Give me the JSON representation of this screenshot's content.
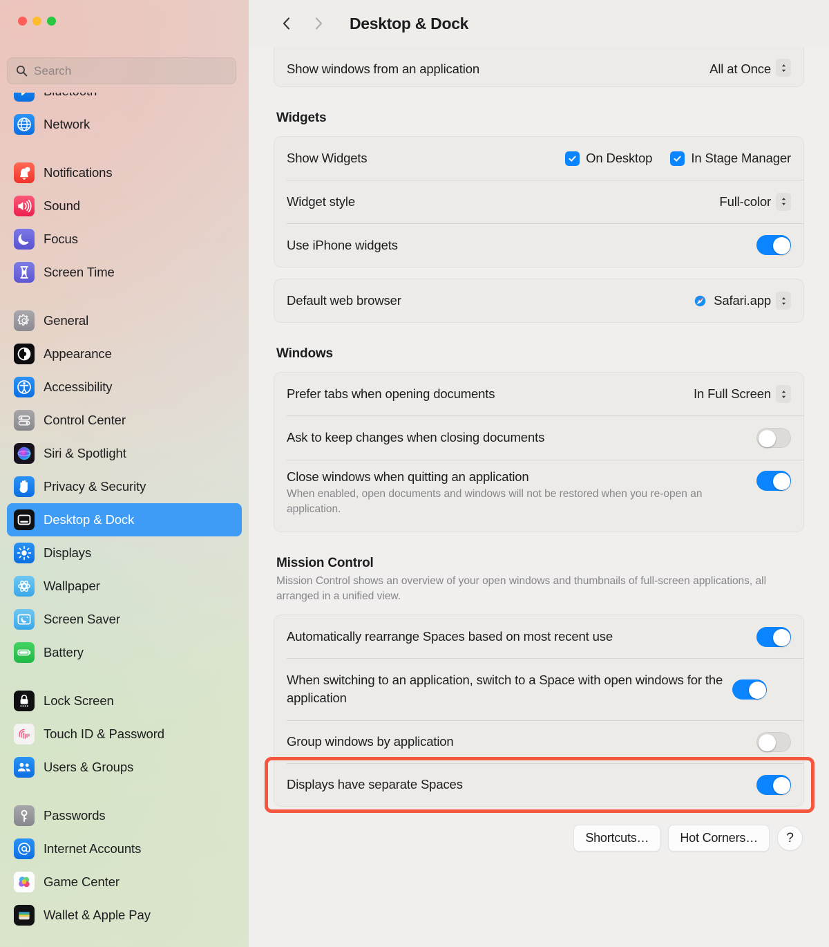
{
  "window": {
    "traffic_lights": [
      "close",
      "minimize",
      "maximize"
    ],
    "colors": {
      "accent_blue": "#0A84FF",
      "selected_sidebar": "#3E9CF7",
      "highlight_red": "#F4573F",
      "content_bg": "#F0EFED",
      "card_bg": "#EDEBE8"
    }
  },
  "sidebar": {
    "search": {
      "placeholder": "Search",
      "value": "",
      "icon": "search-icon"
    },
    "items": [
      {
        "label": "Bluetooth",
        "icon": "bluetooth-icon",
        "selected": false,
        "group": 0,
        "clipped": true
      },
      {
        "label": "Network",
        "icon": "network-globe-icon",
        "selected": false,
        "group": 0
      },
      {
        "label": "Notifications",
        "icon": "notifications-bell-icon",
        "selected": false,
        "group": 1
      },
      {
        "label": "Sound",
        "icon": "sound-speaker-icon",
        "selected": false,
        "group": 1
      },
      {
        "label": "Focus",
        "icon": "focus-moon-icon",
        "selected": false,
        "group": 1
      },
      {
        "label": "Screen Time",
        "icon": "screen-time-hourglass-icon",
        "selected": false,
        "group": 1
      },
      {
        "label": "General",
        "icon": "general-gear-icon",
        "selected": false,
        "group": 2
      },
      {
        "label": "Appearance",
        "icon": "appearance-contrast-icon",
        "selected": false,
        "group": 2
      },
      {
        "label": "Accessibility",
        "icon": "accessibility-icon",
        "selected": false,
        "group": 2
      },
      {
        "label": "Control Center",
        "icon": "control-center-icon",
        "selected": false,
        "group": 2
      },
      {
        "label": "Siri & Spotlight",
        "icon": "siri-icon",
        "selected": false,
        "group": 2
      },
      {
        "label": "Privacy & Security",
        "icon": "privacy-hand-icon",
        "selected": false,
        "group": 2
      },
      {
        "label": "Desktop & Dock",
        "icon": "desktop-dock-icon",
        "selected": true,
        "group": 2
      },
      {
        "label": "Displays",
        "icon": "displays-brightness-icon",
        "selected": false,
        "group": 2
      },
      {
        "label": "Wallpaper",
        "icon": "wallpaper-icon",
        "selected": false,
        "group": 2
      },
      {
        "label": "Screen Saver",
        "icon": "screen-saver-icon",
        "selected": false,
        "group": 2
      },
      {
        "label": "Battery",
        "icon": "battery-icon",
        "selected": false,
        "group": 2
      },
      {
        "label": "Lock Screen",
        "icon": "lock-screen-icon",
        "selected": false,
        "group": 3
      },
      {
        "label": "Touch ID & Password",
        "icon": "touch-id-fingerprint-icon",
        "selected": false,
        "group": 3
      },
      {
        "label": "Users & Groups",
        "icon": "users-groups-icon",
        "selected": false,
        "group": 3
      },
      {
        "label": "Passwords",
        "icon": "passwords-key-icon",
        "selected": false,
        "group": 4
      },
      {
        "label": "Internet Accounts",
        "icon": "internet-accounts-at-icon",
        "selected": false,
        "group": 4
      },
      {
        "label": "Game Center",
        "icon": "game-center-icon",
        "selected": false,
        "group": 4
      },
      {
        "label": "Wallet & Apple Pay",
        "icon": "wallet-apple-pay-icon",
        "selected": false,
        "group": 4
      }
    ]
  },
  "toolbar": {
    "back_icon": "chevron-left-icon",
    "forward_icon": "chevron-right-icon",
    "title": "Desktop & Dock"
  },
  "main": {
    "top_card": {
      "rows": [
        {
          "label": "Show windows from an application",
          "control": "popup",
          "value": "All at Once"
        }
      ]
    },
    "widgets": {
      "section_title": "Widgets",
      "show_widgets": {
        "label": "Show Widgets",
        "checkboxes": [
          {
            "label": "On Desktop",
            "checked": true
          },
          {
            "label": "In Stage Manager",
            "checked": true
          }
        ]
      },
      "widget_style": {
        "label": "Widget style",
        "control": "popup",
        "value": "Full-color"
      },
      "iphone_widgets": {
        "label": "Use iPhone widgets",
        "control": "toggle",
        "on": true
      }
    },
    "browser_card": {
      "default_browser": {
        "label": "Default web browser",
        "control": "popup",
        "value": "Safari.app",
        "icon": "safari-icon"
      }
    },
    "windows": {
      "section_title": "Windows",
      "rows": [
        {
          "label": "Prefer tabs when opening documents",
          "control": "popup",
          "value": "In Full Screen"
        },
        {
          "label": "Ask to keep changes when closing documents",
          "control": "toggle",
          "on": false
        },
        {
          "label": "Close windows when quitting an application",
          "sub": "When enabled, open documents and windows will not be restored when you re-open an application.",
          "control": "toggle",
          "on": true
        }
      ]
    },
    "mission_control": {
      "section_title": "Mission Control",
      "section_desc": "Mission Control shows an overview of your open windows and thumbnails of full-screen applications, all arranged in a unified view.",
      "rows": [
        {
          "label": "Automatically rearrange Spaces based on most recent use",
          "control": "toggle",
          "on": true
        },
        {
          "label": "When switching to an application, switch to a Space with open windows for the application",
          "control": "toggle",
          "on": true
        },
        {
          "label": "Group windows by application",
          "control": "toggle",
          "on": false
        },
        {
          "label": "Displays have separate Spaces",
          "control": "toggle",
          "on": true,
          "highlighted": true
        }
      ]
    },
    "buttons": {
      "shortcuts": "Shortcuts…",
      "hot_corners": "Hot Corners…",
      "help": "?"
    }
  }
}
